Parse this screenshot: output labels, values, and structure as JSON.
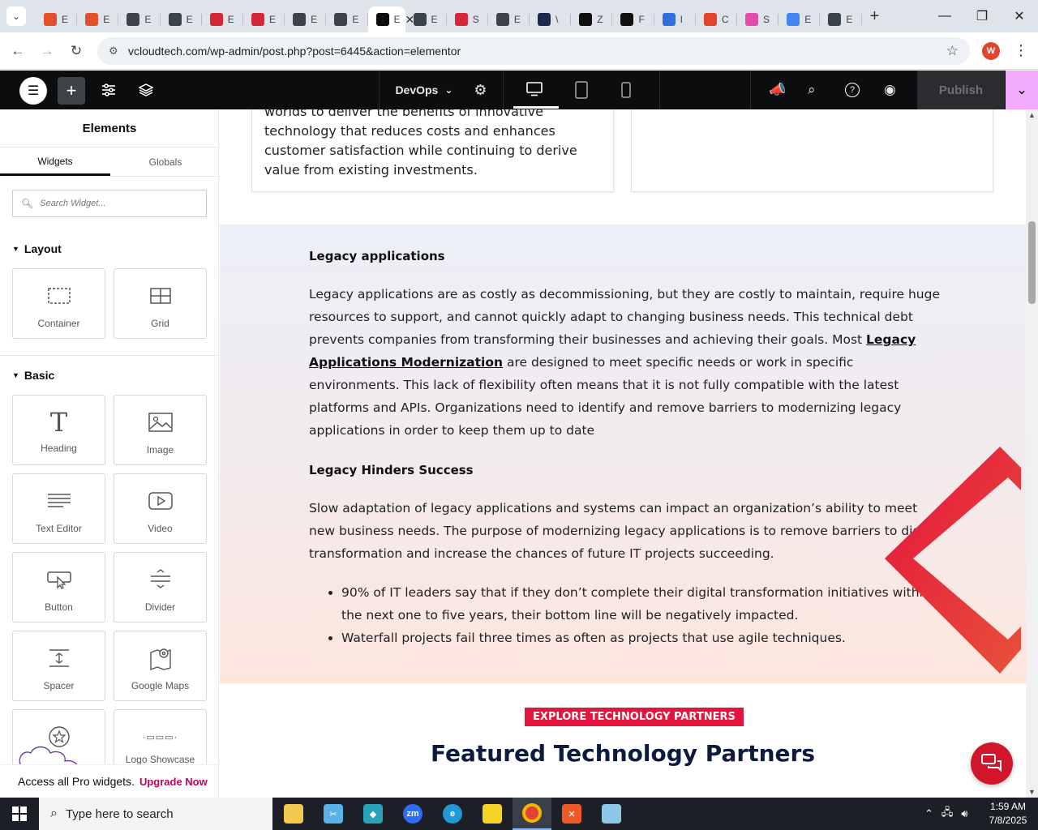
{
  "browser": {
    "tabs": [
      {
        "letter": "E",
        "favicon": "elementor-orange-icon",
        "color": "#e2502c"
      },
      {
        "letter": "E",
        "favicon": "elementor-orange-icon",
        "color": "#e2502c"
      },
      {
        "letter": "E",
        "favicon": "wordpress-icon",
        "color": "#3c434a"
      },
      {
        "letter": "E",
        "favicon": "wordpress-icon",
        "color": "#3c434a"
      },
      {
        "letter": "E",
        "favicon": "diamond-red-icon",
        "color": "#d6263a"
      },
      {
        "letter": "E",
        "favicon": "diamond-red-icon",
        "color": "#d6263a"
      },
      {
        "letter": "E",
        "favicon": "wordpress-icon",
        "color": "#3c434a"
      },
      {
        "letter": "E",
        "favicon": "wordpress-icon",
        "color": "#3c434a"
      },
      {
        "letter": "E",
        "favicon": "elementor-icon",
        "color": "#0c0d0e",
        "active": true
      },
      {
        "letter": "E",
        "favicon": "wordpress-icon",
        "color": "#3c434a"
      },
      {
        "letter": "S",
        "favicon": "diamond-red-icon",
        "color": "#d6263a"
      },
      {
        "letter": "E",
        "favicon": "wordpress-icon",
        "color": "#3c434a"
      },
      {
        "letter": "\\",
        "favicon": "v-logo-icon",
        "color": "#1b2a4a"
      },
      {
        "letter": "Z",
        "favicon": "z-logo-icon",
        "color": "#111111"
      },
      {
        "letter": "F",
        "favicon": "openai-icon",
        "color": "#111111"
      },
      {
        "letter": "I",
        "favicon": "copilot-icon",
        "color": "#2f6fe0"
      },
      {
        "letter": "C",
        "favicon": "scribble-icon",
        "color": "#e0452d"
      },
      {
        "letter": "S",
        "favicon": "ring-icon",
        "color": "#e34ba9"
      },
      {
        "letter": "E",
        "favicon": "google-icon",
        "color": "#4285f4"
      },
      {
        "letter": "E",
        "favicon": "wordpress-icon",
        "color": "#3c434a"
      }
    ],
    "url": "vcloudtech.com/wp-admin/post.php?post=6445&action=elementor",
    "profile_initial": "W"
  },
  "editor": {
    "page_name": "DevOps",
    "publish_label": "Publish",
    "panel_title": "Elements",
    "tab_widgets": "Widgets",
    "tab_globals": "Globals",
    "search_placeholder": "Search Widget...",
    "category_layout": "Layout",
    "category_basic": "Basic",
    "layout_widgets": [
      "Container",
      "Grid"
    ],
    "basic_widgets": [
      "Heading",
      "Image",
      "Text Editor",
      "Video",
      "Button",
      "Divider",
      "Spacer",
      "Google Maps",
      "Icon",
      "Logo Showcase"
    ],
    "upgrade_text": "Access all Pro widgets.",
    "upgrade_link": "Upgrade Now"
  },
  "content": {
    "card_text": "worlds to deliver the benefits of innovative technology that reduces costs and enhances customer satisfaction while continuing to derive value from existing investments.",
    "h1": "Legacy applications",
    "p1_before": "Legacy applications are as costly as decommissioning, but they are costly to maintain, require huge resources to support, and cannot quickly adapt to changing business needs. This technical debt prevents companies from transforming their businesses and achieving their goals. Most ",
    "p1_link": "Legacy Applications Modernization",
    "p1_after": " are designed to meet specific needs or work in specific environments. This lack of flexibility often means that it is not fully compatible with the latest platforms and APIs. Organizations need to identify and remove barriers to modernizing legacy applications in order to keep them up to date",
    "h2": "Legacy Hinders Success",
    "p2": "Slow adaptation of legacy applications and systems can impact an organization’s ability to meet new business needs. The purpose of modernizing legacy applications is to remove barriers to digital transformation and increase the chances of future IT projects succeeding.",
    "bullets": [
      "90% of IT leaders say that if they don’t complete their digital transformation initiatives within the next one to five years, their bottom line will be negatively impacted.",
      "Waterfall projects fail three times as often as projects that use agile techniques."
    ],
    "badge": "EXPLORE TECHNOLOGY PARTNERS",
    "partners_title": "Featured Technology Partners"
  },
  "taskbar": {
    "search_placeholder": "Type here to search",
    "time": "1:59 AM",
    "date": "7/8/2025"
  },
  "colors": {
    "accent_red": "#e4143c",
    "elementor_pink": "#f0abfc",
    "upgrade_pink": "#c4005a"
  }
}
